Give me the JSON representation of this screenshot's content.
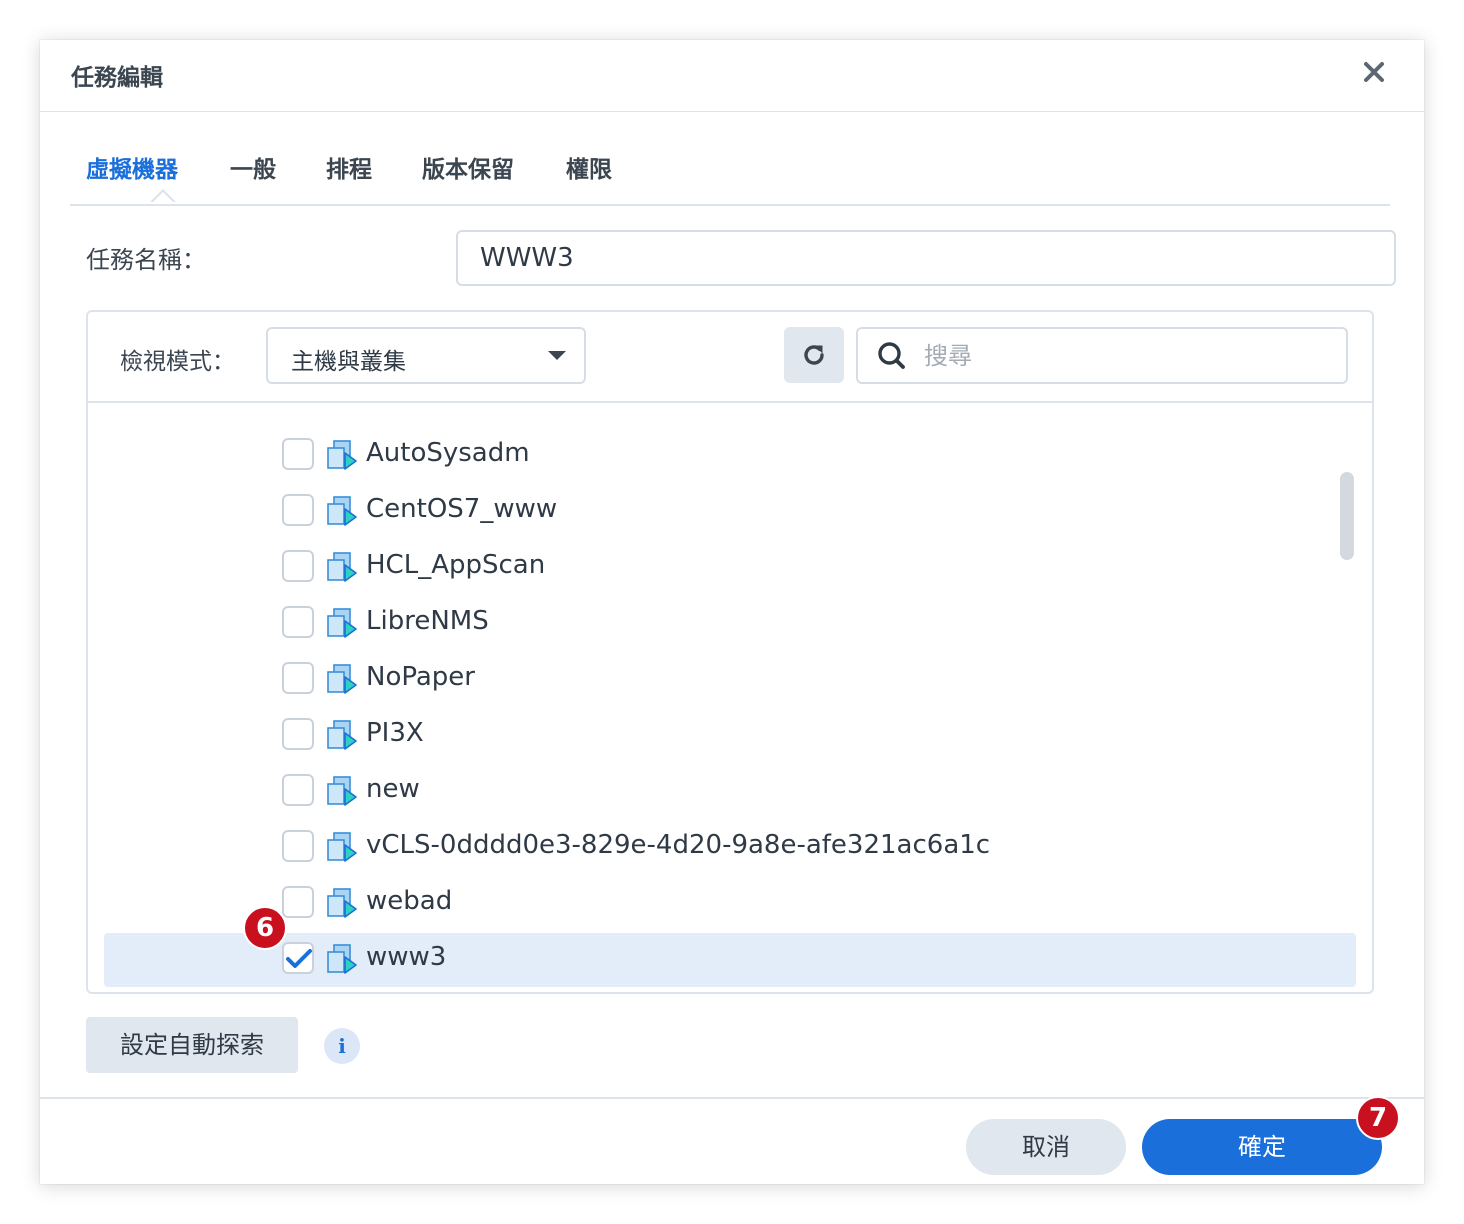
{
  "dialog": {
    "title": "任務編輯"
  },
  "tabs": [
    {
      "label": "虛擬機器",
      "active": true
    },
    {
      "label": "一般"
    },
    {
      "label": "排程"
    },
    {
      "label": "版本保留"
    },
    {
      "label": "權限"
    }
  ],
  "task": {
    "label": "任務名稱：",
    "value": "WWW3"
  },
  "toolbar": {
    "view_label": "檢視模式：",
    "view_value": "主機與叢集",
    "search_placeholder": "搜尋"
  },
  "vms": [
    {
      "name": "AutoSysadm",
      "checked": false
    },
    {
      "name": "CentOS7_www",
      "checked": false
    },
    {
      "name": "HCL_AppScan",
      "checked": false
    },
    {
      "name": "LibreNMS",
      "checked": false
    },
    {
      "name": "NoPaper",
      "checked": false
    },
    {
      "name": "PI3X",
      "checked": false
    },
    {
      "name": "new",
      "checked": false
    },
    {
      "name": "vCLS-0dddd0e3-829e-4d20-9a8e-afe321ac6a1c",
      "checked": false
    },
    {
      "name": "webad",
      "checked": false
    },
    {
      "name": "www3",
      "checked": true
    }
  ],
  "bottom": {
    "auto_discover_label": "設定自動探索"
  },
  "footer": {
    "cancel_label": "取消",
    "ok_label": "確定"
  },
  "annotations": {
    "step6": "6",
    "step7": "7"
  },
  "colors": {
    "accent": "#1a6fdb",
    "badge": "#c8101f",
    "selected_row": "#e2edf9"
  }
}
